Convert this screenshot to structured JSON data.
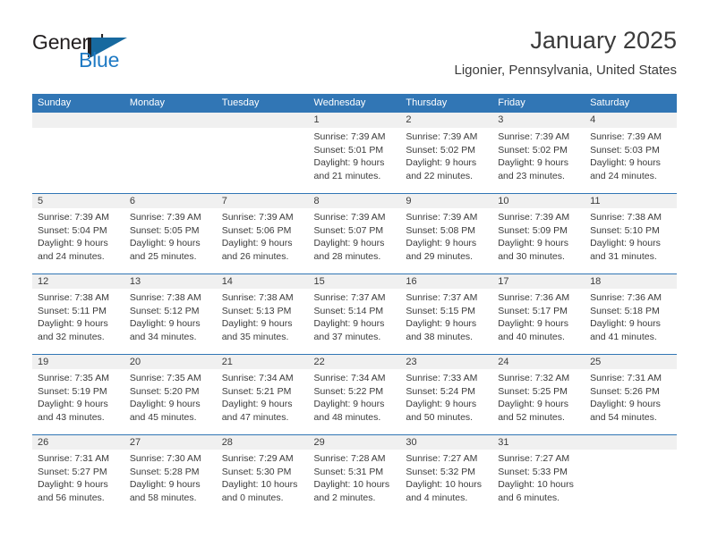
{
  "brand": {
    "name_part1": "General",
    "name_part2": "Blue",
    "accent_color": "#17699f",
    "blue_text_color": "#1f7ac4"
  },
  "header": {
    "title": "January 2025",
    "subtitle": "Ligonier, Pennsylvania, United States"
  },
  "calendar": {
    "header_bg": "#3176b5",
    "number_band_bg": "#f0f0f0",
    "weekdays": [
      "Sunday",
      "Monday",
      "Tuesday",
      "Wednesday",
      "Thursday",
      "Friday",
      "Saturday"
    ],
    "weeks": [
      [
        {
          "day": "",
          "lines": []
        },
        {
          "day": "",
          "lines": []
        },
        {
          "day": "",
          "lines": []
        },
        {
          "day": "1",
          "lines": [
            "Sunrise: 7:39 AM",
            "Sunset: 5:01 PM",
            "Daylight: 9 hours",
            "and 21 minutes."
          ]
        },
        {
          "day": "2",
          "lines": [
            "Sunrise: 7:39 AM",
            "Sunset: 5:02 PM",
            "Daylight: 9 hours",
            "and 22 minutes."
          ]
        },
        {
          "day": "3",
          "lines": [
            "Sunrise: 7:39 AM",
            "Sunset: 5:02 PM",
            "Daylight: 9 hours",
            "and 23 minutes."
          ]
        },
        {
          "day": "4",
          "lines": [
            "Sunrise: 7:39 AM",
            "Sunset: 5:03 PM",
            "Daylight: 9 hours",
            "and 24 minutes."
          ]
        }
      ],
      [
        {
          "day": "5",
          "lines": [
            "Sunrise: 7:39 AM",
            "Sunset: 5:04 PM",
            "Daylight: 9 hours",
            "and 24 minutes."
          ]
        },
        {
          "day": "6",
          "lines": [
            "Sunrise: 7:39 AM",
            "Sunset: 5:05 PM",
            "Daylight: 9 hours",
            "and 25 minutes."
          ]
        },
        {
          "day": "7",
          "lines": [
            "Sunrise: 7:39 AM",
            "Sunset: 5:06 PM",
            "Daylight: 9 hours",
            "and 26 minutes."
          ]
        },
        {
          "day": "8",
          "lines": [
            "Sunrise: 7:39 AM",
            "Sunset: 5:07 PM",
            "Daylight: 9 hours",
            "and 28 minutes."
          ]
        },
        {
          "day": "9",
          "lines": [
            "Sunrise: 7:39 AM",
            "Sunset: 5:08 PM",
            "Daylight: 9 hours",
            "and 29 minutes."
          ]
        },
        {
          "day": "10",
          "lines": [
            "Sunrise: 7:39 AM",
            "Sunset: 5:09 PM",
            "Daylight: 9 hours",
            "and 30 minutes."
          ]
        },
        {
          "day": "11",
          "lines": [
            "Sunrise: 7:38 AM",
            "Sunset: 5:10 PM",
            "Daylight: 9 hours",
            "and 31 minutes."
          ]
        }
      ],
      [
        {
          "day": "12",
          "lines": [
            "Sunrise: 7:38 AM",
            "Sunset: 5:11 PM",
            "Daylight: 9 hours",
            "and 32 minutes."
          ]
        },
        {
          "day": "13",
          "lines": [
            "Sunrise: 7:38 AM",
            "Sunset: 5:12 PM",
            "Daylight: 9 hours",
            "and 34 minutes."
          ]
        },
        {
          "day": "14",
          "lines": [
            "Sunrise: 7:38 AM",
            "Sunset: 5:13 PM",
            "Daylight: 9 hours",
            "and 35 minutes."
          ]
        },
        {
          "day": "15",
          "lines": [
            "Sunrise: 7:37 AM",
            "Sunset: 5:14 PM",
            "Daylight: 9 hours",
            "and 37 minutes."
          ]
        },
        {
          "day": "16",
          "lines": [
            "Sunrise: 7:37 AM",
            "Sunset: 5:15 PM",
            "Daylight: 9 hours",
            "and 38 minutes."
          ]
        },
        {
          "day": "17",
          "lines": [
            "Sunrise: 7:36 AM",
            "Sunset: 5:17 PM",
            "Daylight: 9 hours",
            "and 40 minutes."
          ]
        },
        {
          "day": "18",
          "lines": [
            "Sunrise: 7:36 AM",
            "Sunset: 5:18 PM",
            "Daylight: 9 hours",
            "and 41 minutes."
          ]
        }
      ],
      [
        {
          "day": "19",
          "lines": [
            "Sunrise: 7:35 AM",
            "Sunset: 5:19 PM",
            "Daylight: 9 hours",
            "and 43 minutes."
          ]
        },
        {
          "day": "20",
          "lines": [
            "Sunrise: 7:35 AM",
            "Sunset: 5:20 PM",
            "Daylight: 9 hours",
            "and 45 minutes."
          ]
        },
        {
          "day": "21",
          "lines": [
            "Sunrise: 7:34 AM",
            "Sunset: 5:21 PM",
            "Daylight: 9 hours",
            "and 47 minutes."
          ]
        },
        {
          "day": "22",
          "lines": [
            "Sunrise: 7:34 AM",
            "Sunset: 5:22 PM",
            "Daylight: 9 hours",
            "and 48 minutes."
          ]
        },
        {
          "day": "23",
          "lines": [
            "Sunrise: 7:33 AM",
            "Sunset: 5:24 PM",
            "Daylight: 9 hours",
            "and 50 minutes."
          ]
        },
        {
          "day": "24",
          "lines": [
            "Sunrise: 7:32 AM",
            "Sunset: 5:25 PM",
            "Daylight: 9 hours",
            "and 52 minutes."
          ]
        },
        {
          "day": "25",
          "lines": [
            "Sunrise: 7:31 AM",
            "Sunset: 5:26 PM",
            "Daylight: 9 hours",
            "and 54 minutes."
          ]
        }
      ],
      [
        {
          "day": "26",
          "lines": [
            "Sunrise: 7:31 AM",
            "Sunset: 5:27 PM",
            "Daylight: 9 hours",
            "and 56 minutes."
          ]
        },
        {
          "day": "27",
          "lines": [
            "Sunrise: 7:30 AM",
            "Sunset: 5:28 PM",
            "Daylight: 9 hours",
            "and 58 minutes."
          ]
        },
        {
          "day": "28",
          "lines": [
            "Sunrise: 7:29 AM",
            "Sunset: 5:30 PM",
            "Daylight: 10 hours",
            "and 0 minutes."
          ]
        },
        {
          "day": "29",
          "lines": [
            "Sunrise: 7:28 AM",
            "Sunset: 5:31 PM",
            "Daylight: 10 hours",
            "and 2 minutes."
          ]
        },
        {
          "day": "30",
          "lines": [
            "Sunrise: 7:27 AM",
            "Sunset: 5:32 PM",
            "Daylight: 10 hours",
            "and 4 minutes."
          ]
        },
        {
          "day": "31",
          "lines": [
            "Sunrise: 7:27 AM",
            "Sunset: 5:33 PM",
            "Daylight: 10 hours",
            "and 6 minutes."
          ]
        },
        {
          "day": "",
          "lines": []
        }
      ]
    ]
  }
}
